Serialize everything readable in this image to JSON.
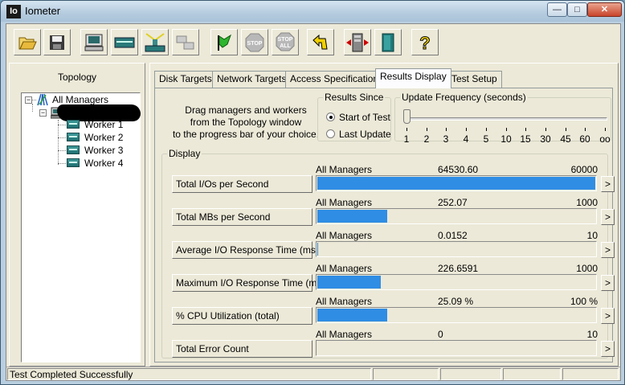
{
  "window": {
    "title": "Iometer",
    "app_icon_text": "Io"
  },
  "toolbar": {
    "buttons": [
      {
        "name": "open-config",
        "icon": "folder-open-icon"
      },
      {
        "name": "save-config",
        "icon": "floppy-disk-icon"
      },
      {
        "name": "new-disk-worker",
        "icon": "disk-worker-icon"
      },
      {
        "name": "new-network-worker",
        "icon": "network-worker-icon"
      },
      {
        "name": "duplicate-worker",
        "icon": "duplicate-worker-icon"
      },
      {
        "name": "manager-worker",
        "icon": "manager-icon"
      },
      {
        "name": "start-tests",
        "icon": "green-flag-icon"
      },
      {
        "name": "stop-test",
        "icon": "stop-sign-icon",
        "label": "STOP"
      },
      {
        "name": "stop-all",
        "icon": "stop-all-icon",
        "label": "STOP ALL"
      },
      {
        "name": "reset-workers",
        "icon": "reset-arrow-icon"
      },
      {
        "name": "new-manager",
        "icon": "new-manager-icon"
      },
      {
        "name": "exit",
        "icon": "exit-door-icon"
      },
      {
        "name": "help",
        "icon": "help-question-icon",
        "label": "?"
      }
    ]
  },
  "topology": {
    "label": "Topology",
    "root": "All Managers",
    "workers": [
      "Worker 1",
      "Worker 2",
      "Worker 3",
      "Worker 4"
    ]
  },
  "tabs": [
    "Disk Targets",
    "Network Targets",
    "Access Specifications",
    "Results Display",
    "Test Setup"
  ],
  "results_display": {
    "drag_text_1": "Drag managers and workers",
    "drag_text_2": "from the Topology window",
    "drag_text_3": "to the progress bar of your choice.",
    "results_since": {
      "legend": "Results Since",
      "options": [
        "Start of Test",
        "Last Update"
      ],
      "selected": "Start of Test"
    },
    "update_frequency": {
      "legend": "Update Frequency (seconds)",
      "ticks": [
        "1",
        "2",
        "3",
        "4",
        "5",
        "10",
        "15",
        "30",
        "45",
        "60",
        "oo"
      ],
      "selected": "1"
    },
    "display": {
      "legend": "Display",
      "metrics": [
        {
          "label": "Total I/Os per Second",
          "source": "All Managers",
          "value": "64530.60",
          "max": "60000",
          "fill": 1.0
        },
        {
          "label": "Total MBs per Second",
          "source": "All Managers",
          "value": "252.07",
          "max": "1000",
          "fill": 0.252
        },
        {
          "label": "Average I/O Response Time (ms)",
          "source": "All Managers",
          "value": "0.0152",
          "max": "10",
          "fill": 0.0015
        },
        {
          "label": "Maximum I/O Response Time (ms)",
          "source": "All Managers",
          "value": "226.6591",
          "max": "1000",
          "fill": 0.227
        },
        {
          "label": "% CPU Utilization (total)",
          "source": "All Managers",
          "value": "25.09 %",
          "max": "100 %",
          "fill": 0.251
        },
        {
          "label": "Total Error Count",
          "source": "All Managers",
          "value": "0",
          "max": "10",
          "fill": 0
        }
      ],
      "arrow_label": ">"
    }
  },
  "status_bar": {
    "message": "Test Completed Successfully"
  },
  "colors": {
    "bar_fill": "#2f8de4",
    "face": "#ece9d8",
    "frame": "#b9cfe0"
  }
}
